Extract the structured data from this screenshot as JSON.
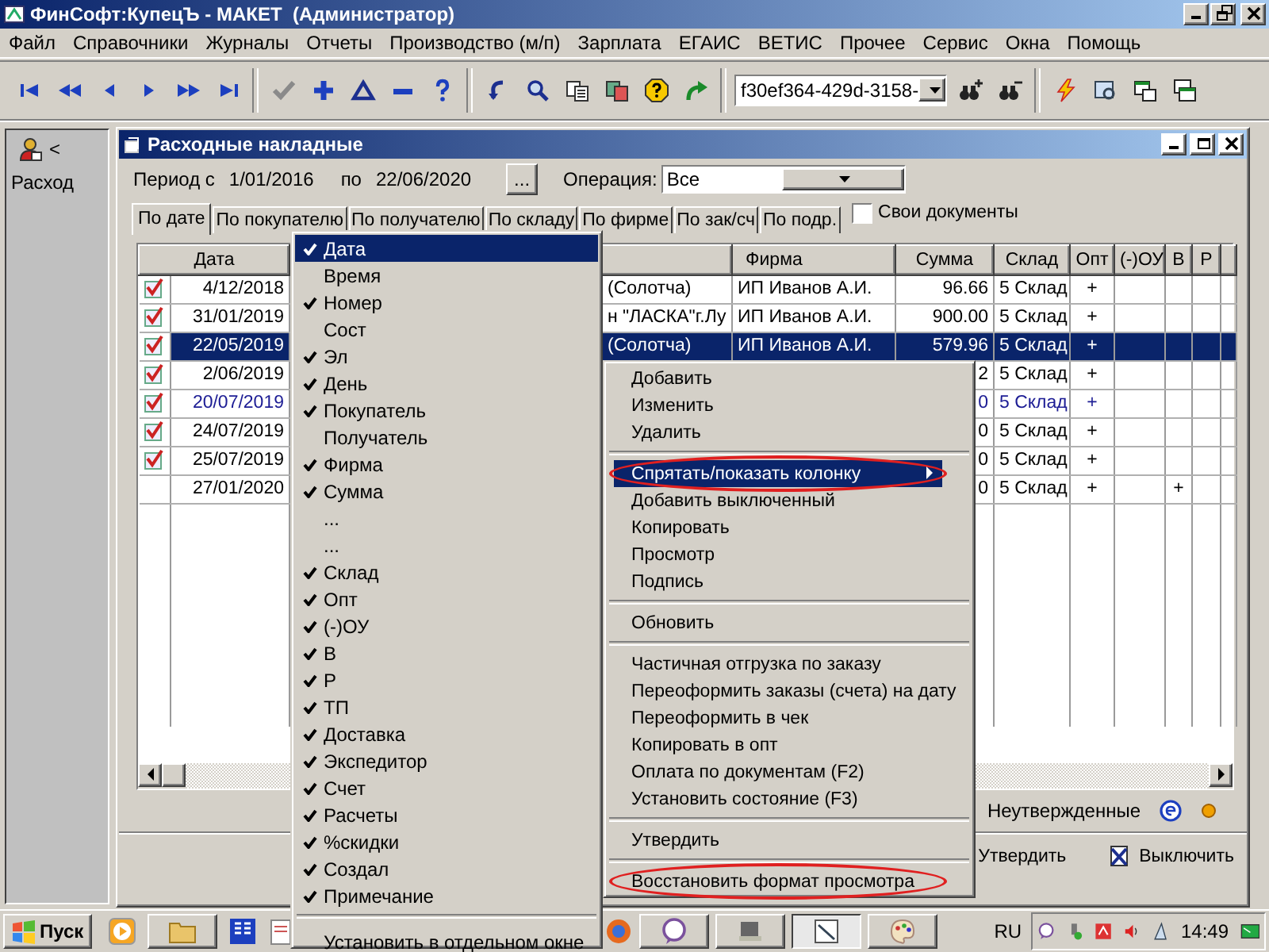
{
  "window": {
    "title": "ФинСофт:КупецЪ - МАКЕТ  (Администратор)"
  },
  "menu_bar": [
    "Файл",
    "Справочники",
    "Журналы",
    "Отчеты",
    "Производство (м/п)",
    "Зарплата",
    "ЕГАИС",
    "ВЕТИС",
    "Прочее",
    "Сервис",
    "Окна",
    "Помощь"
  ],
  "toolbar": {
    "record_combo": "f30ef364-429d-3158-"
  },
  "side_panel": {
    "collapse": "<",
    "label": "Расход"
  },
  "document": {
    "title": "Расходные накладные",
    "period_from_label": "Период с",
    "period_from": "1/01/2016",
    "period_to_label": "по",
    "period_to": "22/06/2020",
    "picker_button": "...",
    "operation_label": "Операция:",
    "operation": "Все",
    "tabs": [
      {
        "label": "По дате",
        "selected": true
      },
      {
        "label": "По покупателю",
        "selected": false
      },
      {
        "label": "По получателю",
        "selected": false
      },
      {
        "label": "По складу",
        "selected": false
      },
      {
        "label": "По фирме",
        "selected": false
      },
      {
        "label": "По зак/сч",
        "selected": false
      },
      {
        "label": "По подр.",
        "selected": false
      }
    ],
    "own_documents": {
      "label": "Свои документы",
      "checked": false
    },
    "table": {
      "columns": [
        "Дата",
        "Фирма",
        "Сумма",
        "Склад",
        "Опт",
        "(-)ОУ",
        "В",
        "Р"
      ],
      "rows": [
        {
          "icon": true,
          "date": "4/12/2018",
          "customer": "(Солотча)",
          "firm": "ИП Иванов А.И.",
          "sum": "96.66",
          "warehouse": "5 Склад",
          "opt": "+",
          "selected": false,
          "color": "#000000"
        },
        {
          "icon": true,
          "date": "31/01/2019",
          "customer": "н \"ЛАСКА\"г.Лу",
          "firm": "ИП Иванов А.И.",
          "sum": "900.00",
          "warehouse": "5 Склад",
          "opt": "+",
          "selected": false,
          "color": "#000000"
        },
        {
          "icon": true,
          "date": "22/05/2019",
          "customer": "(Солотча)",
          "firm": "ИП Иванов А.И.",
          "sum": "579.96",
          "warehouse": "5 Склад",
          "opt": "+",
          "selected": true
        },
        {
          "icon": true,
          "date": "2/06/2019",
          "sum": "2",
          "warehouse": "5 Склад",
          "opt": "+",
          "selected": false,
          "color": "#000000"
        },
        {
          "icon": true,
          "date": "20/07/2019",
          "sum": "0",
          "warehouse": "5 Склад",
          "opt": "+",
          "selected": false,
          "color": "#1c1c94"
        },
        {
          "icon": true,
          "date": "24/07/2019",
          "sum": "0",
          "warehouse": "5 Склад",
          "opt": "+",
          "selected": false,
          "color": "#000000"
        },
        {
          "icon": true,
          "date": "25/07/2019",
          "sum": "0",
          "warehouse": "5 Склад",
          "opt": "+",
          "selected": false,
          "color": "#000000"
        },
        {
          "icon": false,
          "date": "27/01/2020",
          "sum": "0",
          "warehouse": "5 Склад",
          "opt": "+",
          "v": "+",
          "selected": false,
          "color": "#000000"
        }
      ]
    },
    "legend": "Неутвержденные",
    "buttons": [
      {
        "label": "Утвердить",
        "kind": "plain"
      },
      {
        "label": "Выключить",
        "kind": "off"
      }
    ]
  },
  "column_menu": {
    "items": [
      {
        "label": "Дата",
        "checked": true,
        "selected": true
      },
      {
        "label": "Время",
        "checked": false,
        "selected": false
      },
      {
        "label": "Номер",
        "checked": true,
        "selected": false
      },
      {
        "label": "Сост",
        "checked": false,
        "selected": false
      },
      {
        "label": "Эл",
        "checked": true,
        "selected": false
      },
      {
        "label": "День",
        "checked": true,
        "selected": false
      },
      {
        "label": "Покупатель",
        "checked": true,
        "selected": false
      },
      {
        "label": "Получатель",
        "checked": false,
        "selected": false
      },
      {
        "label": "Фирма",
        "checked": true,
        "selected": false
      },
      {
        "label": "Сумма",
        "checked": true,
        "selected": false
      },
      {
        "label": "...",
        "checked": false,
        "selected": false
      },
      {
        "label": "...",
        "checked": false,
        "selected": false
      },
      {
        "label": "Склад",
        "checked": true,
        "selected": false
      },
      {
        "label": "Опт",
        "checked": true,
        "selected": false
      },
      {
        "label": "(-)ОУ",
        "checked": true,
        "selected": false
      },
      {
        "label": "В",
        "checked": true,
        "selected": false
      },
      {
        "label": "Р",
        "checked": true,
        "selected": false
      },
      {
        "label": "ТП",
        "checked": true,
        "selected": false
      },
      {
        "label": "Доставка",
        "checked": true,
        "selected": false
      },
      {
        "label": "Экспедитор",
        "checked": true,
        "selected": false
      },
      {
        "label": "Счет",
        "checked": true,
        "selected": false
      },
      {
        "label": "Расчеты",
        "checked": true,
        "selected": false
      },
      {
        "label": "%скидки",
        "checked": true,
        "selected": false
      },
      {
        "label": "Создал",
        "checked": true,
        "selected": false
      },
      {
        "label": "Примечание",
        "checked": true,
        "selected": false
      }
    ],
    "footer": "Установить в отдельном окне"
  },
  "context_menu": {
    "items": [
      {
        "kind": "item",
        "label": "Добавить",
        "selected": false,
        "submenu": false,
        "annotated": false
      },
      {
        "kind": "item",
        "label": "Изменить",
        "selected": false,
        "submenu": false,
        "annotated": false
      },
      {
        "kind": "item",
        "label": "Удалить",
        "selected": false,
        "submenu": false,
        "annotated": false
      },
      {
        "kind": "separator"
      },
      {
        "kind": "item",
        "label": "Спрятать/показать колонку",
        "selected": true,
        "submenu": true,
        "annotated": true
      },
      {
        "kind": "item",
        "label": "Добавить выключенный",
        "selected": false,
        "submenu": false,
        "annotated": false
      },
      {
        "kind": "item",
        "label": "Копировать",
        "selected": false,
        "submenu": false,
        "annotated": false
      },
      {
        "kind": "item",
        "label": "Просмотр",
        "selected": false,
        "submenu": false,
        "annotated": false
      },
      {
        "kind": "item",
        "label": "Подпись",
        "selected": false,
        "submenu": false,
        "annotated": false
      },
      {
        "kind": "separator"
      },
      {
        "kind": "item",
        "label": "Обновить",
        "selected": false,
        "submenu": false,
        "annotated": false
      },
      {
        "kind": "separator"
      },
      {
        "kind": "item",
        "label": "Частичная отгрузка по заказу",
        "selected": false,
        "submenu": false,
        "annotated": false
      },
      {
        "kind": "item",
        "label": "Переоформить заказы (счета) на дату",
        "selected": false,
        "submenu": false,
        "annotated": false
      },
      {
        "kind": "item",
        "label": "Переоформить в чек",
        "selected": false,
        "submenu": false,
        "annotated": false
      },
      {
        "kind": "item",
        "label": "Копировать в опт",
        "selected": false,
        "submenu": false,
        "annotated": false
      },
      {
        "kind": "item",
        "label": "Оплата по документам (F2)",
        "selected": false,
        "submenu": false,
        "annotated": false
      },
      {
        "kind": "item",
        "label": "Установить состояние (F3)",
        "selected": false,
        "submenu": false,
        "annotated": false
      },
      {
        "kind": "separator"
      },
      {
        "kind": "item",
        "label": "Утвердить",
        "selected": false,
        "submenu": false,
        "annotated": false
      },
      {
        "kind": "separator"
      },
      {
        "kind": "item",
        "label": "Восстановить формат просмотра",
        "selected": false,
        "submenu": false,
        "annotated": true
      }
    ]
  },
  "taskbar": {
    "start": "Пуск",
    "language": "RU",
    "clock": "14:49"
  }
}
